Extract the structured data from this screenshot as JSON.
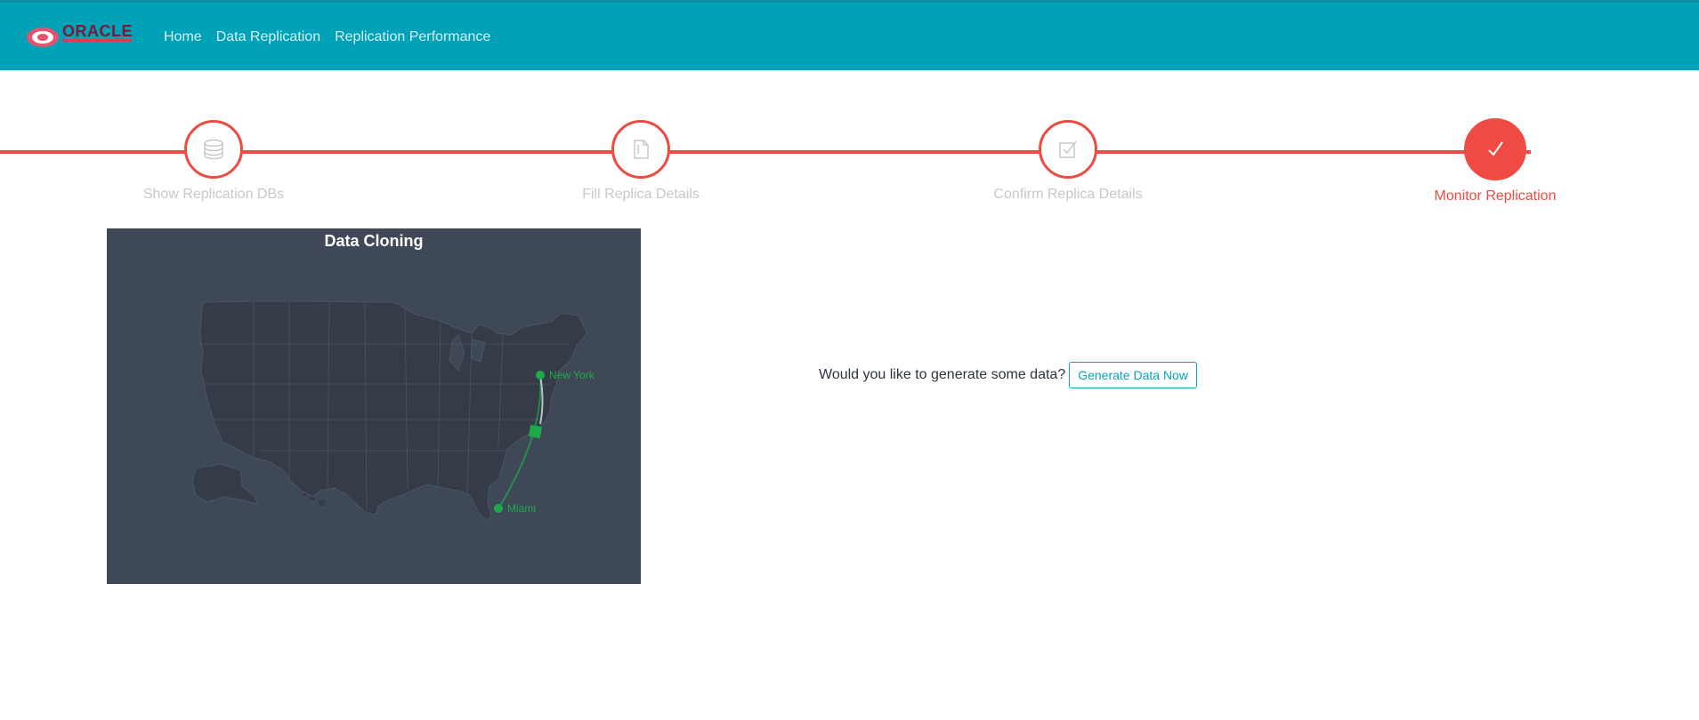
{
  "brand": {
    "logo_text": "ORACLE"
  },
  "nav": {
    "items": [
      "Home",
      "Data Replication",
      "Replication Performance"
    ]
  },
  "stepper": {
    "steps": [
      {
        "label": "Show Replication DBs",
        "icon": "database-icon",
        "active": false
      },
      {
        "label": "Fill Replica Details",
        "icon": "document-icon",
        "active": false
      },
      {
        "label": "Confirm Replica Details",
        "icon": "checkbox-icon",
        "active": false
      },
      {
        "label": "Monitor Replication",
        "icon": "checkmark-icon",
        "active": true
      }
    ]
  },
  "map": {
    "title": "Data Cloning",
    "cities": {
      "source": "New York",
      "destination": "Miami"
    }
  },
  "action": {
    "prompt": "Would you like to generate some data?",
    "button_label": "Generate Data Now"
  },
  "colors": {
    "topbar": "#00a2b8",
    "accent": "#ef4a43",
    "map_background": "#3f4856",
    "route": "#1eaa4a"
  }
}
